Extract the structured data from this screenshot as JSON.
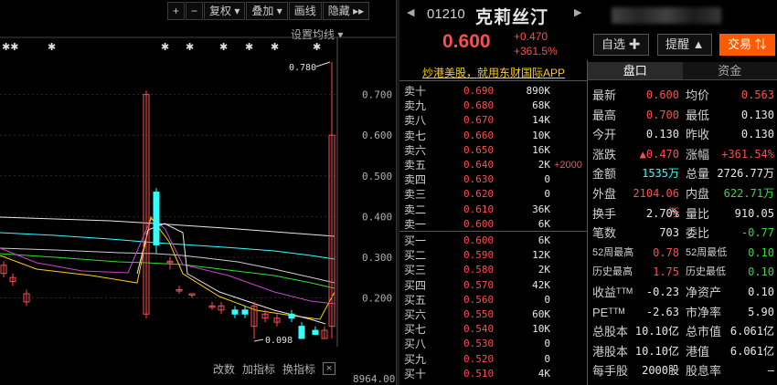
{
  "toolbar": {
    "plus": "+",
    "minus": "−",
    "adjust": "复权 ▾",
    "overlay": "叠加 ▾",
    "draw": "画线",
    "hide": "隐藏 ▸▸"
  },
  "chart": {
    "settings_label": "设置均线 ▾",
    "star_markers": [
      "✱✱",
      "✱",
      "✱",
      "✱",
      "✱",
      "✱",
      "✱",
      "✱",
      "✱",
      "✱✱"
    ],
    "high_marker": "0.780",
    "low_marker": "0.098",
    "bottom_buttons": [
      "改数",
      "加指标",
      "换指标"
    ],
    "close_glyph": "×",
    "volume_label": "8964.00"
  },
  "chart_data": {
    "type": "candlestick",
    "y_ticks": [
      "0.700",
      "0.600",
      "0.500",
      "0.400",
      "0.300",
      "0.200"
    ],
    "ylim": [
      0.1,
      0.78
    ],
    "grid": true
  },
  "quote": {
    "nav_prev": "◀",
    "nav_next": "▶",
    "code": "01210",
    "name": "克莉丝汀",
    "price": "0.600",
    "change": "+0.470",
    "change_pct": "+361.5%",
    "btn_watch": "自选 ✚",
    "btn_alert": "提醒 ▲",
    "btn_trade": "交易 ⇅",
    "ad_text": "炒港美股，就用东财国际APP",
    "tabs": [
      "盘口",
      "资金"
    ]
  },
  "order_book": {
    "asks": [
      {
        "label": "卖十",
        "price": "0.690",
        "vol": "890K",
        "extra": ""
      },
      {
        "label": "卖九",
        "price": "0.680",
        "vol": "68K",
        "extra": ""
      },
      {
        "label": "卖八",
        "price": "0.670",
        "vol": "14K",
        "extra": ""
      },
      {
        "label": "卖七",
        "price": "0.660",
        "vol": "10K",
        "extra": ""
      },
      {
        "label": "卖六",
        "price": "0.650",
        "vol": "16K",
        "extra": ""
      },
      {
        "label": "卖五",
        "price": "0.640",
        "vol": "2K",
        "extra": "+2000"
      },
      {
        "label": "卖四",
        "price": "0.630",
        "vol": "0",
        "extra": ""
      },
      {
        "label": "卖三",
        "price": "0.620",
        "vol": "0",
        "extra": ""
      },
      {
        "label": "卖二",
        "price": "0.610",
        "vol": "36K",
        "extra": ""
      },
      {
        "label": "卖一",
        "price": "0.600",
        "vol": "6K",
        "extra": ""
      }
    ],
    "bids": [
      {
        "label": "买一",
        "price": "0.600",
        "vol": "6K"
      },
      {
        "label": "买二",
        "price": "0.590",
        "vol": "12K"
      },
      {
        "label": "买三",
        "price": "0.580",
        "vol": "2K"
      },
      {
        "label": "买四",
        "price": "0.570",
        "vol": "42K"
      },
      {
        "label": "买五",
        "price": "0.560",
        "vol": "0"
      },
      {
        "label": "买六",
        "price": "0.550",
        "vol": "60K"
      },
      {
        "label": "买七",
        "price": "0.540",
        "vol": "10K"
      },
      {
        "label": "买八",
        "price": "0.530",
        "vol": "0"
      },
      {
        "label": "买九",
        "price": "0.520",
        "vol": "0"
      },
      {
        "label": "买十",
        "price": "0.510",
        "vol": "4K"
      }
    ]
  },
  "stats": [
    {
      "l1": "最新",
      "v1": "0.600",
      "c1": "red",
      "l2": "均价",
      "v2": "0.563",
      "c2": "red"
    },
    {
      "l1": "最高",
      "v1": "0.700",
      "c1": "red",
      "l2": "最低",
      "v2": "0.130",
      "c2": "white"
    },
    {
      "l1": "今开",
      "v1": "0.130",
      "c1": "white",
      "l2": "昨收",
      "v2": "0.130",
      "c2": "white"
    },
    {
      "l1": "涨跌",
      "v1": "▲0.470",
      "c1": "red",
      "l2": "涨幅",
      "v2": "+361.54%",
      "c2": "red"
    },
    {
      "l1": "金额",
      "v1": "1535万",
      "c1": "cyan",
      "l2": "总量",
      "v2": "2726.77万",
      "c2": "white"
    },
    {
      "l1": "外盘",
      "v1": "2104.06万",
      "c1": "red",
      "l2": "内盘",
      "v2": "622.71万",
      "c2": "green"
    },
    {
      "l1": "换手",
      "v1": "2.70%",
      "c1": "white",
      "l2": "量比",
      "v2": "910.05",
      "c2": "white"
    },
    {
      "l1": "笔数",
      "v1": "703",
      "c1": "white",
      "l2": "委比",
      "v2": "-0.77",
      "c2": "green"
    },
    {
      "l1": "52周最高",
      "v1": "0.78",
      "c1": "red",
      "l2": "52周最低",
      "v2": "0.10",
      "c2": "green",
      "sm": true
    },
    {
      "l1": "历史最高",
      "v1": "1.75",
      "c1": "red",
      "l2": "历史最低",
      "v2": "0.10",
      "c2": "green",
      "sm": true
    },
    {
      "l1": "收益ᵀᵀᴹ",
      "v1": "-0.23",
      "c1": "white",
      "l2": "净资产",
      "v2": "0.10",
      "c2": "white"
    },
    {
      "l1": "PEᵀᵀᴹ",
      "v1": "-2.63",
      "c1": "white",
      "l2": "市净率",
      "v2": "5.90",
      "c2": "white"
    },
    {
      "l1": "总股本",
      "v1": "10.10亿",
      "c1": "white",
      "l2": "总市值",
      "v2": "6.061亿",
      "c2": "white"
    },
    {
      "l1": "港股本",
      "v1": "10.10亿",
      "c1": "white",
      "l2": "港值",
      "v2": "6.061亿",
      "c2": "white"
    },
    {
      "l1": "每手股",
      "v1": "2000股",
      "c1": "white",
      "l2": "股息率",
      "v2": "—",
      "c2": "white"
    }
  ],
  "colors": {
    "up": "#ff4d4d",
    "down": "#33ffff",
    "accent": "#ff5a00",
    "ad": "#ffd000"
  }
}
